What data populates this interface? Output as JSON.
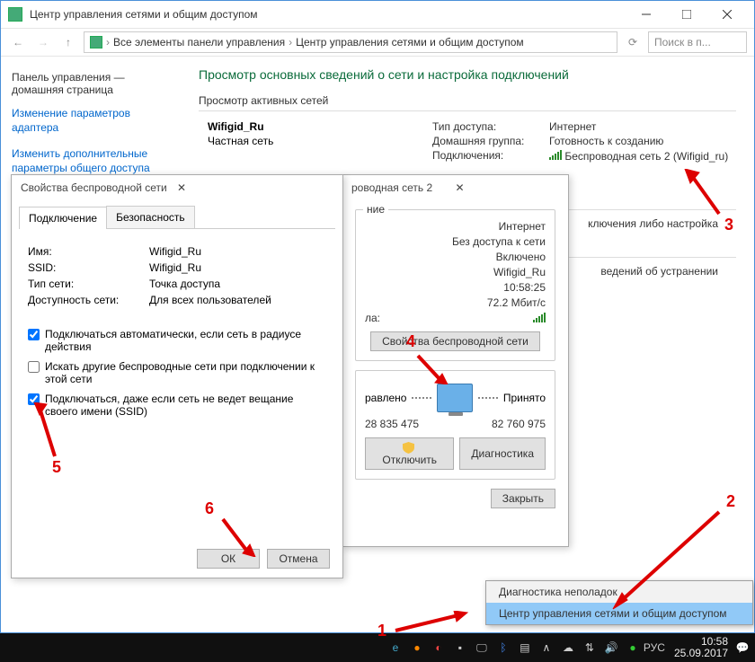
{
  "main_window": {
    "title": "Центр управления сетями и общим доступом",
    "breadcrumb": {
      "root": "Все элементы панели управления",
      "leaf": "Центр управления сетями и общим доступом"
    },
    "search_placeholder": "Поиск в п...",
    "sidebar": {
      "header": "Панель управления — домашняя страница",
      "links": [
        "Изменение параметров адаптера",
        "Изменить дополнительные параметры общего доступа"
      ]
    },
    "page_title": "Просмотр основных сведений о сети и настройка подключений",
    "active_nets_header": "Просмотр активных сетей",
    "network": {
      "name": "Wifigid_Ru",
      "type": "Частная сеть"
    },
    "right": {
      "access_label": "Тип доступа:",
      "access_value": "Интернет",
      "homegroup_label": "Домашняя группа:",
      "homegroup_value": "Готовность к созданию",
      "conn_label": "Подключения:",
      "conn_value": "Беспроводная сеть 2 (Wifigid_ru)"
    },
    "extra1": "ключения либо настройка",
    "extra2": "ведений об устранении"
  },
  "status_dialog": {
    "title": "роводная сеть 2",
    "group1": "ние",
    "rows1": [
      {
        "k": "",
        "v": "Интернет"
      },
      {
        "k": "",
        "v": "Без доступа к сети"
      },
      {
        "k": "",
        "v": "Включено"
      },
      {
        "k": "",
        "v": "Wifigid_Ru"
      },
      {
        "k": "",
        "v": "10:58:25"
      },
      {
        "k": "",
        "v": "72.2 Мбит/с"
      }
    ],
    "signal_label": "ла:",
    "props_btn": "Свойства беспроводной сети",
    "sent": "равлено",
    "recv": "Принято",
    "bytes_sent": "28 835 475",
    "bytes_recv": "82 760 975",
    "disable": "Отключить",
    "diag": "Диагностика",
    "close": "Закрыть"
  },
  "props_dialog": {
    "title": "Свойства беспроводной сети",
    "tabs": [
      "Подключение",
      "Безопасность"
    ],
    "rows": [
      {
        "k": "Имя:",
        "v": "Wifigid_Ru"
      },
      {
        "k": "SSID:",
        "v": "Wifigid_Ru"
      },
      {
        "k": "Тип сети:",
        "v": "Точка доступа"
      },
      {
        "k": "Доступность сети:",
        "v": "Для всех пользователей"
      }
    ],
    "checks": [
      {
        "checked": true,
        "label": "Подключаться автоматически, если сеть в радиусе действия"
      },
      {
        "checked": false,
        "label": "Искать другие беспроводные сети при подключении к этой сети"
      },
      {
        "checked": true,
        "label": "Подключаться, даже если сеть не ведет вещание своего имени (SSID)"
      }
    ],
    "ok": "ОК",
    "cancel": "Отмена"
  },
  "context_menu": {
    "items": [
      "Диагностика неполадок",
      "Центр управления сетями и общим доступом"
    ],
    "highlight": 1
  },
  "taskbar": {
    "lang": "РУС",
    "time": "10:58",
    "date": "25.09.2017"
  },
  "annotations": {
    "1": "1",
    "2": "2",
    "3": "3",
    "4": "4",
    "5": "5",
    "6": "6"
  }
}
